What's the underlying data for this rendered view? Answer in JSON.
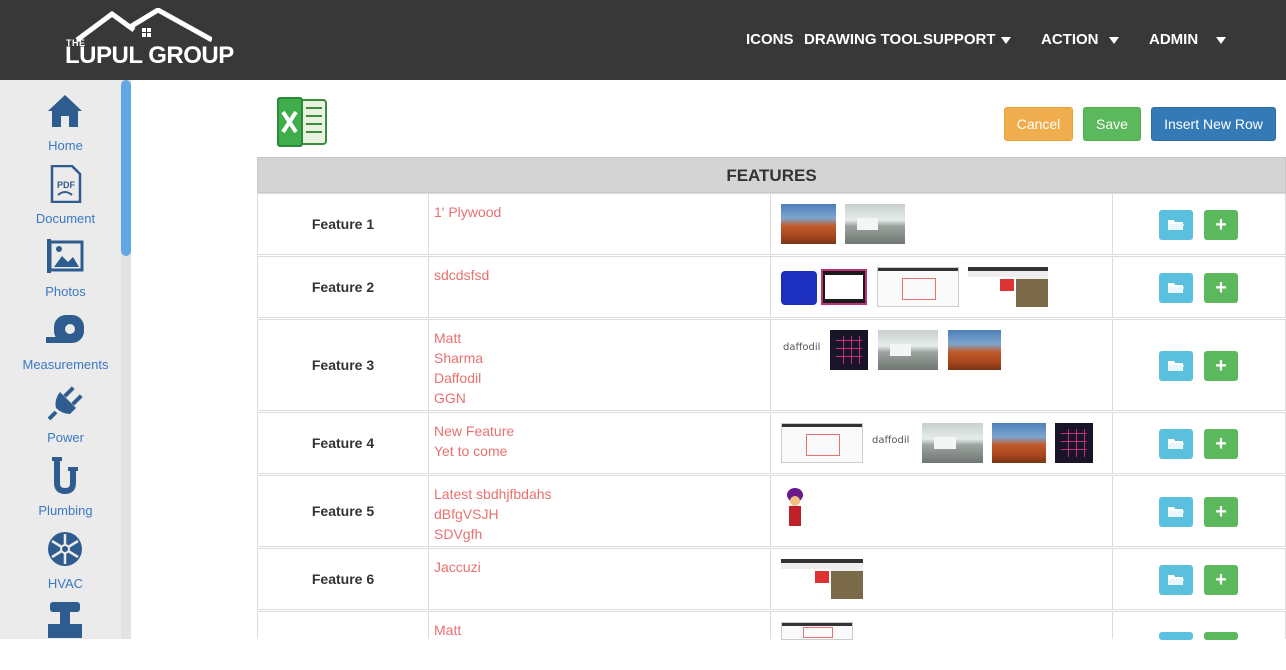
{
  "header": {
    "logo_the": "THE",
    "logo_brand": "LUPUL GROUP",
    "nav": [
      "ICONS",
      "DRAWING TOOL",
      "SUPPORT",
      "ACTION",
      "ADMIN"
    ]
  },
  "sidebar": {
    "items": [
      {
        "label": "Home",
        "icon": "home-icon"
      },
      {
        "label": "Document",
        "icon": "pdf-icon"
      },
      {
        "label": "Photos",
        "icon": "photos-icon"
      },
      {
        "label": "Measurements",
        "icon": "tape-measure-icon"
      },
      {
        "label": "Power",
        "icon": "plug-icon"
      },
      {
        "label": "Plumbing",
        "icon": "pipe-icon"
      },
      {
        "label": "HVAC",
        "icon": "snowflake-icon"
      },
      {
        "label": "",
        "icon": "appliance-icon"
      }
    ]
  },
  "toolbar": {
    "cancel": "Cancel",
    "save": "Save",
    "insert": "Insert New Row"
  },
  "table": {
    "title": "FEATURES",
    "rows": [
      {
        "name": "Feature 1",
        "values": [
          "1' Plywood"
        ]
      },
      {
        "name": "Feature 2",
        "values": [
          "sdcdsfsd"
        ]
      },
      {
        "name": "Feature 3",
        "values": [
          "Matt",
          "Sharma",
          "Daffodil",
          "GGN"
        ]
      },
      {
        "name": "Feature 4",
        "values": [
          "New Feature",
          "Yet to come"
        ]
      },
      {
        "name": "Feature 5",
        "values": [
          "Latest sbdhjfbdahs",
          "dBfgVSJH",
          "SDVgfh"
        ]
      },
      {
        "name": "Feature 6",
        "values": [
          "Jaccuzi"
        ]
      },
      {
        "name": "",
        "values": [
          "Matt"
        ]
      }
    ]
  },
  "thumb_text": {
    "daffodil": "daffodil"
  },
  "colors": {
    "header_bg": "#383838",
    "sidebar_bg": "#ebebeb",
    "sidebar_text": "#3a79c4",
    "value_text": "#e8716f",
    "cancel": "#f0ad4e",
    "save": "#5cb85c",
    "insert": "#337ab7",
    "folder_btn": "#5bc0de"
  }
}
